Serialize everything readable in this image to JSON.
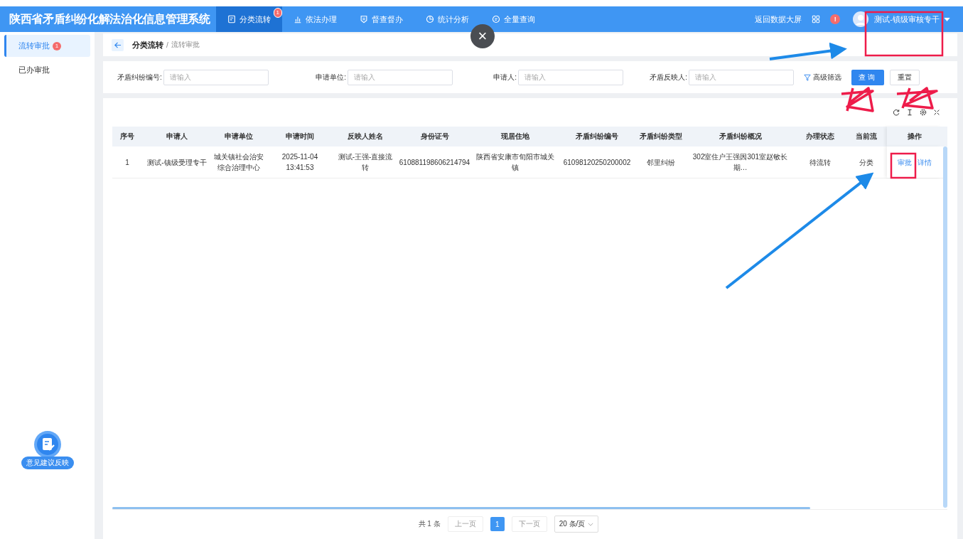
{
  "header": {
    "title": "陕西省矛盾纠纷化解法治化信息管理系统",
    "nav": [
      {
        "label": "分类流转",
        "badge": "1",
        "selected": true
      },
      {
        "label": "依法办理",
        "selected": false
      },
      {
        "label": "督查督办",
        "selected": false
      },
      {
        "label": "统计分析",
        "selected": false
      },
      {
        "label": "全量查询",
        "selected": false
      }
    ],
    "back_link": "返回数据大屏",
    "alert_badge": "!",
    "user": "测试-镇级审核专干"
  },
  "sidebar": {
    "items": [
      {
        "label": "流转审批",
        "badge": "1",
        "selected": true
      },
      {
        "label": "已办审批",
        "selected": false
      }
    ],
    "feedback": "意见建议反映"
  },
  "close_button": "×",
  "breadcrumb": {
    "current": "分类流转",
    "separator": "/",
    "parent": "流转审批"
  },
  "filters": [
    {
      "label": "矛盾纠纷编号:",
      "placeholder": "请输入"
    },
    {
      "label": "申请单位:",
      "placeholder": "请输入"
    },
    {
      "label": "申请人:",
      "placeholder": "请输入"
    },
    {
      "label": "矛盾反映人:",
      "placeholder": "请输入"
    }
  ],
  "advanced": "高级筛选",
  "query_button": "查询",
  "reset_button": "重置",
  "table": {
    "columns": [
      "序号",
      "申请人",
      "申请单位",
      "申请时间",
      "反映人姓名",
      "身份证号",
      "现居住地",
      "矛盾纠纷编号",
      "矛盾纠纷类型",
      "矛盾纠纷概况",
      "办理状态",
      "当前流",
      "操作"
    ],
    "rows": [
      {
        "cells": [
          "1",
          "测试-镇级受理专干",
          "城关镇社会治安综合治理中心",
          "2025-11-04 13:41:53",
          "测试-王强-直接流转",
          "610881198606214794",
          "陕西省安康市旬阳市城关镇",
          "61098120250200002",
          "邻里纠纷",
          "302室住户王强因301室赵敏长期…",
          "待流转",
          "分类"
        ],
        "actions": [
          "审批",
          "详情"
        ]
      }
    ]
  },
  "pagination": {
    "total": "共 1 条",
    "prev": "上一页",
    "pages": [
      {
        "label": "1",
        "selected": true
      }
    ],
    "next": "下一页",
    "page_size": "20 条/页"
  }
}
